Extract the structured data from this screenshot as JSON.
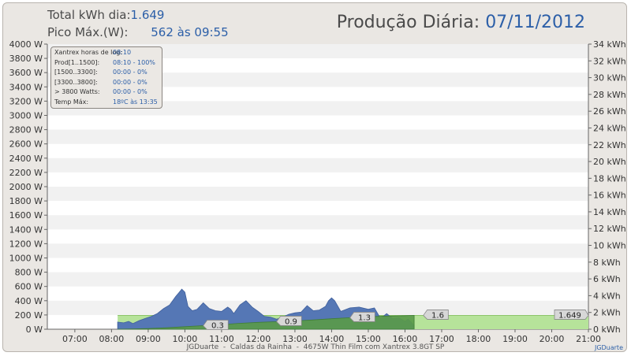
{
  "header": {
    "total_label": "Total kWh dia:",
    "total_value": "1.649",
    "peak_label": "Pico Máx.(W):",
    "peak_value": "562 às 09:55",
    "title_label": "Produção Diária:",
    "title_date": "07/11/2012"
  },
  "infobox": [
    {
      "label": "Xantrex horas de log:",
      "value": "08:10"
    },
    {
      "label": "Prod[1..1500]:",
      "value": "08:10 - 100%"
    },
    {
      "label": "[1500..3300]:",
      "value": "00:00 - 0%"
    },
    {
      "label": "[3300..3800]:",
      "value": "00:00 - 0%"
    },
    {
      "label": "> 3800 Watts:",
      "value": "00:00 - 0%"
    },
    {
      "label": "Temp Máx:",
      "value": "18ºC às 13:35"
    }
  ],
  "footer": "JGDuarte  -  Caldas da Rainha  -  4675W Thin Film com Xantrex 3.8GT SP",
  "credit": "JGDuarte",
  "colors": {
    "power": "#5577b5",
    "energy": "#5a9a4a",
    "projection": "#b6e39a",
    "band": "#f1f1f1"
  },
  "chart_data": {
    "type": "area",
    "x_range": [
      "06:15",
      "21:00"
    ],
    "x_ticks": [
      "07:00",
      "08:00",
      "09:00",
      "10:00",
      "11:00",
      "12:00",
      "13:00",
      "14:00",
      "15:00",
      "16:00",
      "17:00",
      "18:00",
      "19:00",
      "20:00",
      "21:00"
    ],
    "y_left": {
      "unit": "W",
      "min": 0,
      "max": 4000,
      "ticks": [
        "0 W",
        "200 W",
        "400 W",
        "600 W",
        "800 W",
        "1000 W",
        "1200 W",
        "1400 W",
        "1600 W",
        "1800 W",
        "2000 W",
        "2200 W",
        "2400 W",
        "2600 W",
        "2800 W",
        "3000 W",
        "3200 W",
        "3400 W",
        "3600 W",
        "3800 W",
        "4000 W"
      ]
    },
    "y_right": {
      "unit": "kWh",
      "min": 0,
      "max": 34,
      "ticks": [
        "0 kWh",
        "2 kWh",
        "4 kWh",
        "6 kWh",
        "8 kWh",
        "10 kWh",
        "12 kWh",
        "14 kWh",
        "16 kWh",
        "18 kWh",
        "20 kWh",
        "22 kWh",
        "24 kWh",
        "26 kWh",
        "28 kWh",
        "30 kWh",
        "32 kWh",
        "34 kWh"
      ]
    },
    "power_series": {
      "x": [
        "08:10",
        "08:20",
        "08:28",
        "08:35",
        "08:45",
        "08:55",
        "09:05",
        "09:15",
        "09:25",
        "09:35",
        "09:45",
        "09:50",
        "09:55",
        "10:00",
        "10:05",
        "10:12",
        "10:20",
        "10:30",
        "10:40",
        "10:50",
        "11:00",
        "11:10",
        "11:15",
        "11:20",
        "11:30",
        "11:40",
        "11:50",
        "12:00",
        "12:10",
        "12:20",
        "12:30",
        "12:40",
        "12:50",
        "13:00",
        "13:10",
        "13:20",
        "13:30",
        "13:40",
        "13:50",
        "13:55",
        "14:00",
        "14:05",
        "14:15",
        "14:30",
        "14:45",
        "15:00",
        "15:10",
        "15:20",
        "15:30",
        "15:40",
        "15:50",
        "16:00",
        "16:05",
        "16:10",
        "16:15"
      ],
      "y": [
        100,
        90,
        110,
        80,
        120,
        150,
        180,
        220,
        290,
        340,
        460,
        510,
        562,
        520,
        320,
        260,
        280,
        370,
        290,
        260,
        250,
        310,
        280,
        220,
        340,
        400,
        310,
        250,
        180,
        170,
        140,
        170,
        210,
        230,
        240,
        330,
        260,
        270,
        320,
        400,
        440,
        400,
        250,
        300,
        310,
        280,
        300,
        150,
        220,
        150,
        160,
        110,
        140,
        100,
        50
      ]
    },
    "energy_series": {
      "x": [
        "08:10",
        "08:35",
        "09:00",
        "09:30",
        "10:00",
        "10:30",
        "11:00",
        "11:30",
        "12:00",
        "12:30",
        "13:00",
        "13:30",
        "14:00",
        "14:30",
        "15:00",
        "15:30",
        "16:00",
        "16:10",
        "16:15"
      ],
      "y": [
        0.0,
        0.03,
        0.08,
        0.17,
        0.3,
        0.42,
        0.55,
        0.7,
        0.82,
        0.9,
        0.99,
        1.11,
        1.25,
        1.37,
        1.48,
        1.57,
        1.62,
        1.64,
        1.649
      ]
    },
    "projection": {
      "from": "08:10",
      "to": "21:00",
      "value": 1.649
    },
    "annotations": [
      {
        "x": "10:30",
        "y": 0.42,
        "label": "0.3"
      },
      {
        "x": "12:30",
        "y": 0.9,
        "label": "0.9"
      },
      {
        "x": "14:30",
        "y": 1.37,
        "label": "1.3"
      },
      {
        "x": "16:30",
        "y": 1.649,
        "label": "1.6"
      },
      {
        "x": "21:00",
        "y": 1.649,
        "label": "1.649"
      }
    ],
    "grid": "horizontal-bands"
  }
}
